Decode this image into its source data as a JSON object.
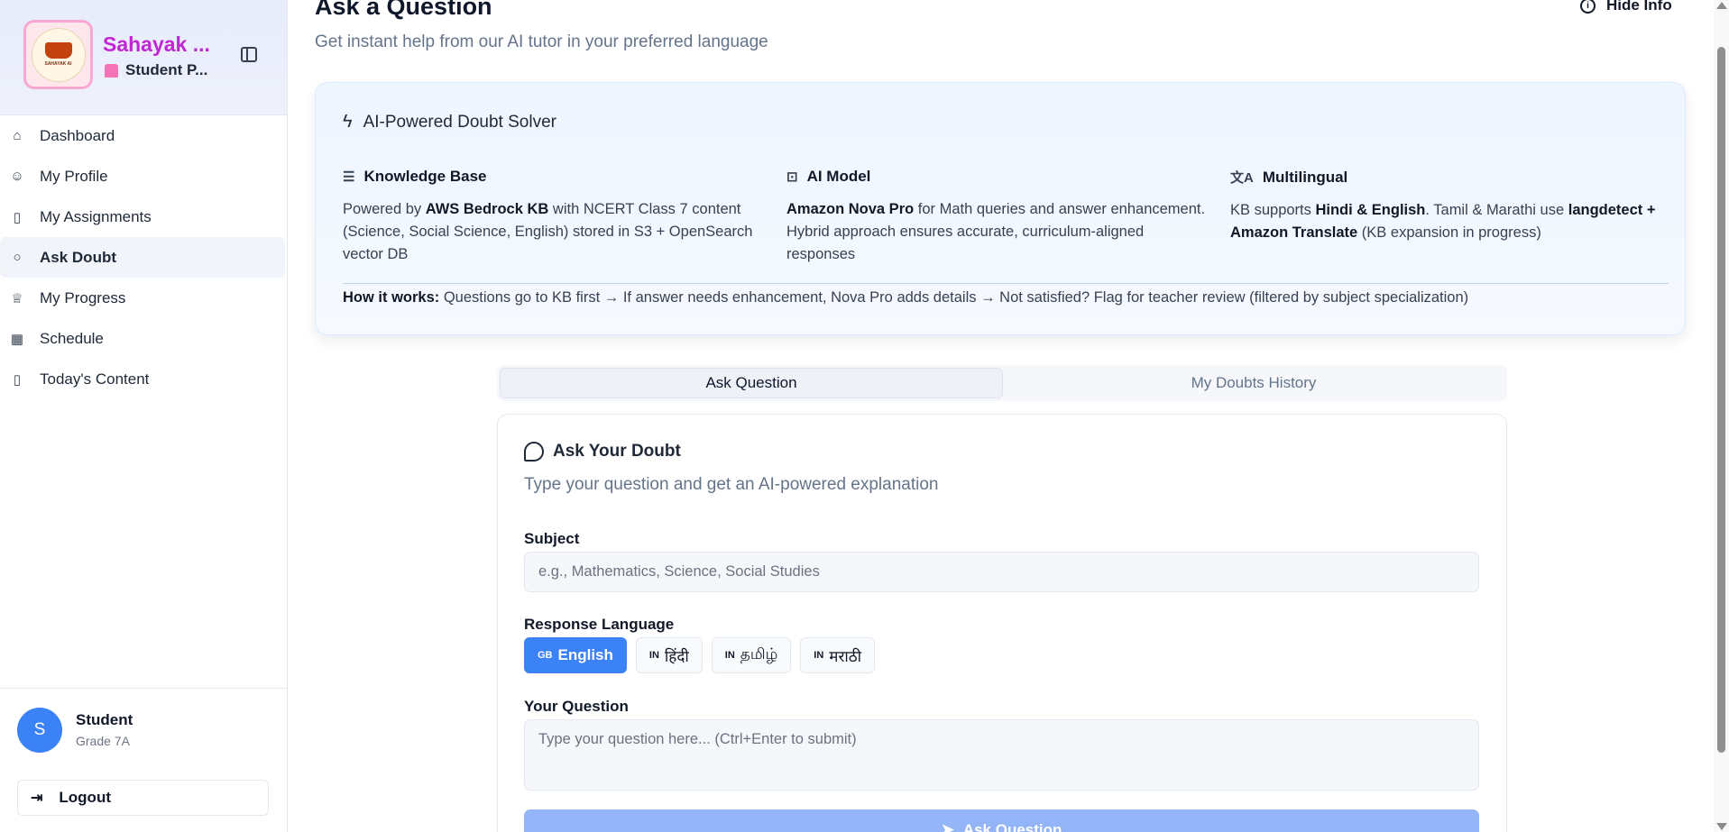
{
  "sidebar": {
    "brand_title": "Sahayak ...",
    "brand_subtitle": "Student P...",
    "logo_text": "SAHAYAK AI",
    "items": [
      {
        "label": "Dashboard",
        "icon": "home-icon"
      },
      {
        "label": "My Profile",
        "icon": "user-icon"
      },
      {
        "label": "My Assignments",
        "icon": "book-open-icon"
      },
      {
        "label": "Ask Doubt",
        "icon": "message-circle-icon",
        "active": true
      },
      {
        "label": "My Progress",
        "icon": "trophy-icon"
      },
      {
        "label": "Schedule",
        "icon": "calendar-icon"
      },
      {
        "label": "Today's Content",
        "icon": "book-open-icon"
      }
    ],
    "user": {
      "initial": "S",
      "name": "Student",
      "grade": "Grade 7A"
    },
    "logout_label": "Logout"
  },
  "header": {
    "title": "Ask a Question",
    "subtitle": "Get instant help from our AI tutor in your preferred language",
    "hide_info_label": "Hide Info"
  },
  "info": {
    "title": "AI-Powered Doubt Solver",
    "columns": [
      {
        "heading": "Knowledge Base",
        "icon": "database-icon",
        "t1": "Powered by ",
        "b1": "AWS Bedrock KB",
        "t2": " with NCERT Class 7 content (Science, Social Science, English) stored in S3 + OpenSearch vector DB"
      },
      {
        "heading": "AI Model",
        "icon": "bot-icon",
        "b1": "Amazon Nova Pro",
        "t2": " for Math queries and answer enhancement. Hybrid approach ensures accurate, curriculum-aligned responses"
      },
      {
        "heading": "Multilingual",
        "icon": "languages-icon",
        "t1": "KB supports ",
        "b1": "Hindi & English",
        "t2": ". Tamil & Marathi use ",
        "b2": "langdetect + Amazon Translate",
        "t3": " (KB expansion in progress)"
      }
    ],
    "how_label": "How it works:",
    "how_text": " Questions go to KB first → If answer needs enhancement, Nova Pro adds details → Not satisfied? Flag for teacher review (filtered by subject specialization)"
  },
  "tabs": [
    {
      "label": "Ask Question",
      "active": true
    },
    {
      "label": "My Doubts History",
      "active": false
    }
  ],
  "form": {
    "title": "Ask Your Doubt",
    "subtitle": "Type your question and get an AI-powered explanation",
    "subject_label": "Subject",
    "subject_placeholder": "e.g., Mathematics, Science, Social Studies",
    "language_label": "Response Language",
    "languages": [
      {
        "code": "GB",
        "label": "English",
        "active": true
      },
      {
        "code": "IN",
        "label": "हिंदी",
        "active": false
      },
      {
        "code": "IN",
        "label": "தமிழ்",
        "active": false
      },
      {
        "code": "IN",
        "label": "मराठी",
        "active": false
      }
    ],
    "question_label": "Your Question",
    "question_placeholder": "Type your question here... (Ctrl+Enter to submit)",
    "submit_label": "Ask Question"
  },
  "colors": {
    "accent": "#3b82f6",
    "brand": "#c026d3"
  }
}
